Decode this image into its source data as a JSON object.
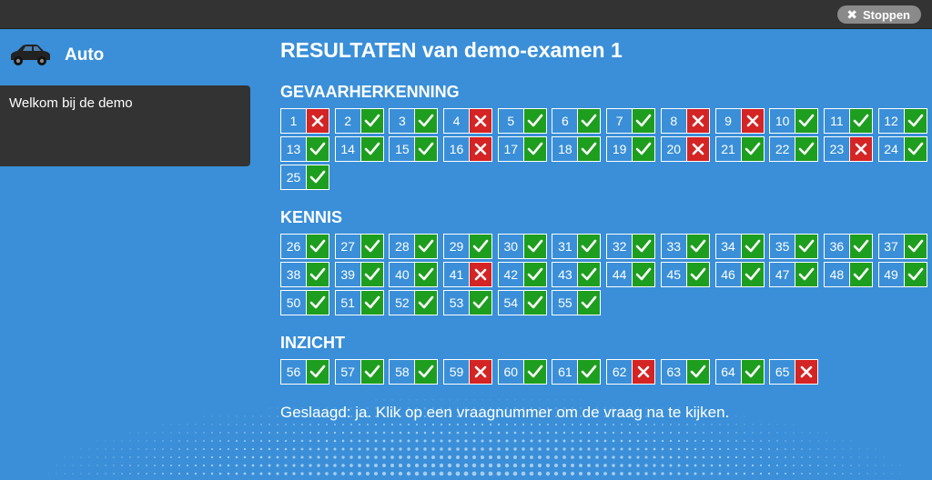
{
  "topbar": {
    "stop_label": "Stoppen"
  },
  "sidebar": {
    "app_title": "Auto",
    "items": [
      {
        "label": "Welkom bij de demo"
      }
    ]
  },
  "main": {
    "title": "RESULTATEN van demo-examen 1",
    "sections": [
      {
        "title": "GEVAARHERKENNING",
        "questions": [
          {
            "n": "1",
            "ok": false
          },
          {
            "n": "2",
            "ok": true
          },
          {
            "n": "3",
            "ok": true
          },
          {
            "n": "4",
            "ok": false
          },
          {
            "n": "5",
            "ok": true
          },
          {
            "n": "6",
            "ok": true
          },
          {
            "n": "7",
            "ok": true
          },
          {
            "n": "8",
            "ok": false
          },
          {
            "n": "9",
            "ok": false
          },
          {
            "n": "10",
            "ok": true
          },
          {
            "n": "11",
            "ok": true
          },
          {
            "n": "12",
            "ok": true
          },
          {
            "n": "13",
            "ok": true
          },
          {
            "n": "14",
            "ok": true
          },
          {
            "n": "15",
            "ok": true
          },
          {
            "n": "16",
            "ok": false
          },
          {
            "n": "17",
            "ok": true
          },
          {
            "n": "18",
            "ok": true
          },
          {
            "n": "19",
            "ok": true
          },
          {
            "n": "20",
            "ok": false
          },
          {
            "n": "21",
            "ok": true
          },
          {
            "n": "22",
            "ok": true
          },
          {
            "n": "23",
            "ok": false
          },
          {
            "n": "24",
            "ok": true
          },
          {
            "n": "25",
            "ok": true
          }
        ]
      },
      {
        "title": "KENNIS",
        "questions": [
          {
            "n": "26",
            "ok": true
          },
          {
            "n": "27",
            "ok": true
          },
          {
            "n": "28",
            "ok": true
          },
          {
            "n": "29",
            "ok": true
          },
          {
            "n": "30",
            "ok": true
          },
          {
            "n": "31",
            "ok": true
          },
          {
            "n": "32",
            "ok": true
          },
          {
            "n": "33",
            "ok": true
          },
          {
            "n": "34",
            "ok": true
          },
          {
            "n": "35",
            "ok": true
          },
          {
            "n": "36",
            "ok": true
          },
          {
            "n": "37",
            "ok": true
          },
          {
            "n": "38",
            "ok": true
          },
          {
            "n": "39",
            "ok": true
          },
          {
            "n": "40",
            "ok": true
          },
          {
            "n": "41",
            "ok": false
          },
          {
            "n": "42",
            "ok": true
          },
          {
            "n": "43",
            "ok": true
          },
          {
            "n": "44",
            "ok": true
          },
          {
            "n": "45",
            "ok": true
          },
          {
            "n": "46",
            "ok": true
          },
          {
            "n": "47",
            "ok": true
          },
          {
            "n": "48",
            "ok": true
          },
          {
            "n": "49",
            "ok": true
          },
          {
            "n": "50",
            "ok": true
          },
          {
            "n": "51",
            "ok": true
          },
          {
            "n": "52",
            "ok": true
          },
          {
            "n": "53",
            "ok": true
          },
          {
            "n": "54",
            "ok": true
          },
          {
            "n": "55",
            "ok": true
          }
        ]
      },
      {
        "title": "INZICHT",
        "questions": [
          {
            "n": "56",
            "ok": true
          },
          {
            "n": "57",
            "ok": true
          },
          {
            "n": "58",
            "ok": true
          },
          {
            "n": "59",
            "ok": false
          },
          {
            "n": "60",
            "ok": true
          },
          {
            "n": "61",
            "ok": true
          },
          {
            "n": "62",
            "ok": false
          },
          {
            "n": "63",
            "ok": true
          },
          {
            "n": "64",
            "ok": true
          },
          {
            "n": "65",
            "ok": false
          }
        ]
      }
    ],
    "footer": "Geslaagd: ja. Klik op een vraagnummer om de vraag na te kijken."
  },
  "icons": {
    "correct": "check-icon",
    "incorrect": "cross-icon",
    "car": "car-icon",
    "stop": "close-icon"
  },
  "colors": {
    "background": "#3a8fd8",
    "topbar": "#333333",
    "correct": "#1e9e1e",
    "incorrect": "#d42424"
  }
}
